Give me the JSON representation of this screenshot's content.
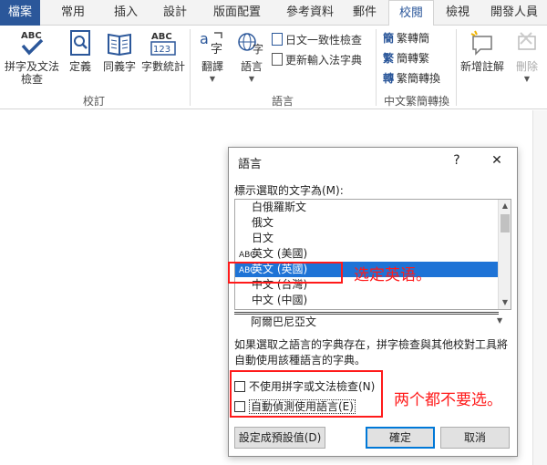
{
  "tabs": [
    "檔案",
    "常用",
    "插入",
    "設計",
    "版面配置",
    "參考資料",
    "郵件",
    "校閱",
    "檢視",
    "開發人員"
  ],
  "ribbon": {
    "proofing": {
      "spell_abc": "ABC",
      "spell_label_1": "拼字及文法",
      "spell_label_2": "檢查",
      "define": "定義",
      "thesaurus": "同義字",
      "wordcount_abc": "ABC",
      "wordcount_num": "123",
      "wordcount": "字數統計",
      "group": "校訂"
    },
    "language": {
      "translate": "翻譯",
      "language": "語言",
      "consistency": "日文一致性檢查",
      "update_ime": "更新輸入法字典",
      "group": "語言"
    },
    "chinese": {
      "to_simplified": "繁轉簡",
      "to_traditional": "簡轉繁",
      "convert": "繁簡轉換",
      "group": "中文繁簡轉換"
    },
    "comments": {
      "new_comment": "新增註解",
      "delete": "刪除"
    }
  },
  "dialog": {
    "title": "語言",
    "help": "?",
    "close": "✕",
    "prompt": "標示選取的文字為(M):",
    "languages": [
      {
        "name": "白俄羅斯文",
        "spell": false,
        "selected": false
      },
      {
        "name": "俄文",
        "spell": false,
        "selected": false
      },
      {
        "name": "日文",
        "spell": false,
        "selected": false
      },
      {
        "name": "英文 (美國)",
        "spell": true,
        "selected": false
      },
      {
        "name": "英文 (英國)",
        "spell": true,
        "selected": true
      },
      {
        "name": "中文 (台灣)",
        "spell": false,
        "selected": false
      },
      {
        "name": "中文 (中國)",
        "spell": false,
        "selected": false
      }
    ],
    "below_separator": "阿爾巴尼亞文",
    "spell_mark": "ABC",
    "description_1": "如果選取之語言的字典存在，拼字檢查與其他校對工具將",
    "description_2": "自動使用該種語言的字典。",
    "no_proofing": "不使用拼字或文法檢查(N)",
    "detect_language": "自動偵測使用語言(E)",
    "set_default": "設定成預設值(D)",
    "ok": "確定",
    "cancel": "取消"
  },
  "annotations": {
    "select_english": "选定英语。",
    "both_unchecked": "两个都不要选。"
  },
  "colors": {
    "accent": "#2b579a",
    "selection": "#1e73d6",
    "annotation": "#ff1a1a"
  }
}
